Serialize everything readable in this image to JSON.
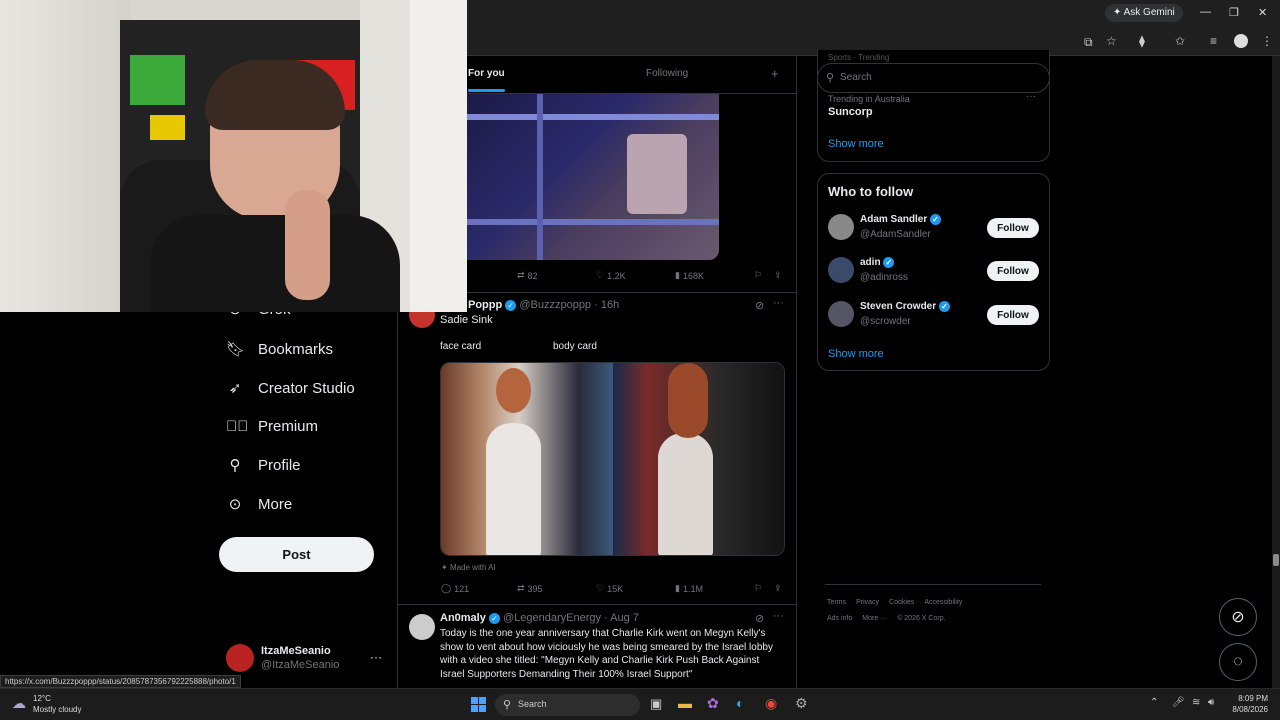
{
  "browser": {
    "ask_gemini": "Ask Gemini",
    "status_url": "https://x.com/Buzzzpoppp/status/2085787356792225888/photo/1"
  },
  "nav": {
    "items": [
      {
        "label": "Grok",
        "icon": "grok-icon"
      },
      {
        "label": "Bookmarks",
        "icon": "bookmark-icon"
      },
      {
        "label": "Creator Studio",
        "icon": "rocket-icon"
      },
      {
        "label": "Premium",
        "icon": "verified-badge-icon"
      },
      {
        "label": "Profile",
        "icon": "person-icon"
      },
      {
        "label": "More",
        "icon": "more-circle-icon"
      }
    ],
    "post_label": "Post",
    "account_name": "ItzaMeSeanio",
    "account_handle": "@ItzaMeSeanio"
  },
  "feed": {
    "tabs": [
      "For you",
      "Following"
    ],
    "prev_post_stats": {
      "reposts": "82",
      "likes": "1.2K",
      "views": "168K"
    },
    "post1": {
      "name": "Poppp",
      "handle": "@Buzzzpoppp",
      "time": "· 16h",
      "text": "Sadie Sink",
      "caption_left": "face card",
      "caption_right": "body card",
      "made_with_ai": "Made with AI",
      "stats": {
        "replies": "121",
        "reposts": "395",
        "likes": "15K",
        "views": "1.1M"
      }
    },
    "post2": {
      "name": "An0maly",
      "handle": "@LegendaryEnergy",
      "time": "· Aug 7",
      "lines": [
        "Today is the one year anniversary that Charlie Kirk went on Megyn Kelly's",
        "show to vent about how viciously he was being smeared by the Israel lobby",
        "with a video she titled: \"Megyn Kelly and Charlie Kirk Push Back Against",
        "Israel Supporters Demanding Their 100% Israel Support\""
      ]
    }
  },
  "right": {
    "search_placeholder": "Search",
    "sports_label": "Sports · Trending",
    "trend_context": "Trending in Australia",
    "trend_name": "Suncorp",
    "show_more_trends": "Show more",
    "who_to_follow_title": "Who to follow",
    "follow_label": "Follow",
    "suggestions": [
      {
        "name": "Adam Sandler",
        "handle": "@AdamSandler"
      },
      {
        "name": "adin",
        "handle": "@adinross"
      },
      {
        "name": "Steven Crowder",
        "handle": "@scrowder"
      }
    ],
    "show_more_follow": "Show more",
    "footer_row1": [
      "Terms",
      "Privacy",
      "Cookies",
      "Accessibility"
    ],
    "footer_row2": [
      "Ads info",
      "More ···",
      "© 2026 X Corp."
    ]
  },
  "taskbar": {
    "temp": "12°C",
    "weather": "Mostly cloudy",
    "search_label": "Search",
    "time": "8:09 PM",
    "date": "8/08/2026"
  }
}
